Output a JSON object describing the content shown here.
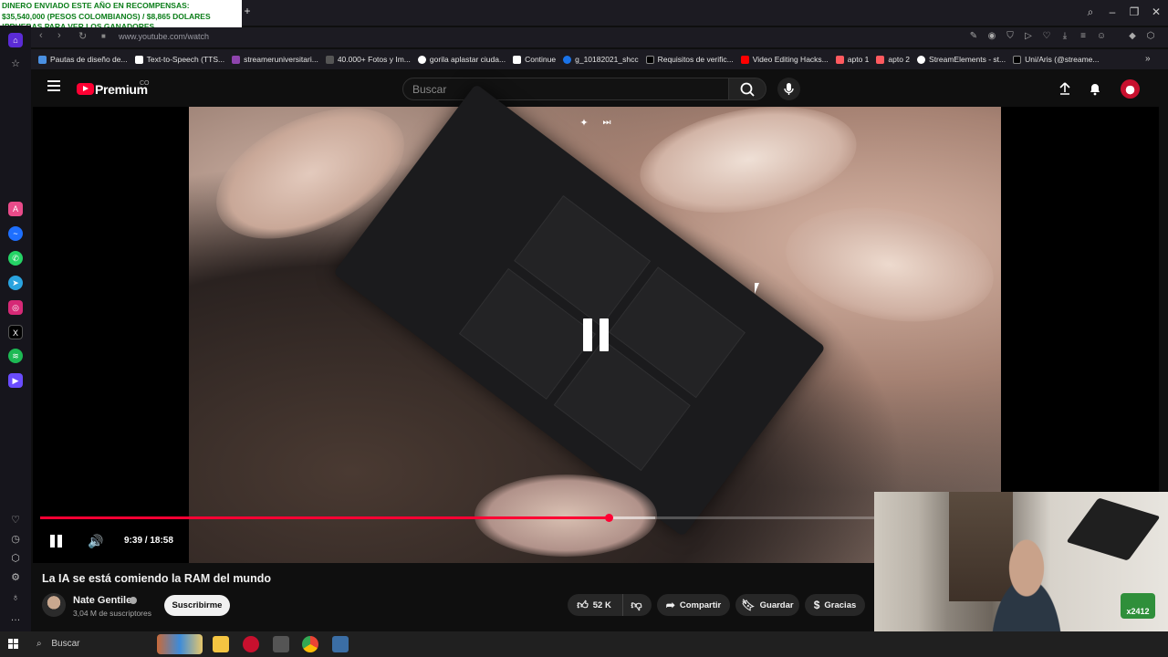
{
  "overlay_banner": {
    "line1": "DINERO ENVIADO ESTE AÑO EN RECOMPENSAS:",
    "line2": " $35,540,000 (PESOS COLOMBIANOS) / $8,865 DOLARES",
    "line3": "!PRUEBAS PARA VER LOS GANADORES"
  },
  "browser": {
    "url": "www.youtube.com/watch",
    "bookmarks": [
      {
        "label": "Pautas de diseño de...",
        "color": "#4a90e2"
      },
      {
        "label": "Text-to-Speech (TTS...",
        "color": "#ffffff"
      },
      {
        "label": "streameruniversitari...",
        "color": "#8e44ad"
      },
      {
        "label": "40.000+ Fotos y Im...",
        "color": "#222222"
      },
      {
        "label": "gorila aplastar ciuda...",
        "color": "#ffffff"
      },
      {
        "label": "Continue",
        "color": "#ffffff"
      },
      {
        "label": "g_10182021_shcc",
        "color": "#1a73e8"
      },
      {
        "label": "Requisitos de verific...",
        "color": "#000000"
      },
      {
        "label": "Video Editing Hacks...",
        "color": "#ff0000"
      },
      {
        "label": "apto 1",
        "color": "#ff5a5f"
      },
      {
        "label": "apto 2",
        "color": "#ff5a5f"
      },
      {
        "label": "StreamElements - st...",
        "color": "#ffffff"
      },
      {
        "label": "Uni/Aris (@streame...",
        "color": "#000000"
      }
    ]
  },
  "youtube": {
    "brand": "Premium",
    "brand_sup": "CO",
    "search_placeholder": "Buscar"
  },
  "player": {
    "current_time": "9:39",
    "duration": "18:58",
    "time_label": "9:39 / 18:58",
    "progress_fraction": 0.508,
    "buffer_fraction": 0.55,
    "state": "paused-indicator"
  },
  "video": {
    "title": "La IA se está comiendo la RAM del mundo",
    "channel": "Nate Gentile",
    "subscribers": "3,04 M de suscriptores",
    "subscribe_label": "Suscribirme",
    "likes": "52 K",
    "share_label": "Compartir",
    "save_label": "Guardar",
    "thanks_label": "Gracias"
  },
  "webcam": {
    "badge": "x2412"
  },
  "taskbar": {
    "search_label": "Buscar"
  },
  "colors": {
    "accent": "#ff0033",
    "background": "#0f0f0f",
    "pill": "#272727",
    "banner_text": "#0a7d18"
  }
}
